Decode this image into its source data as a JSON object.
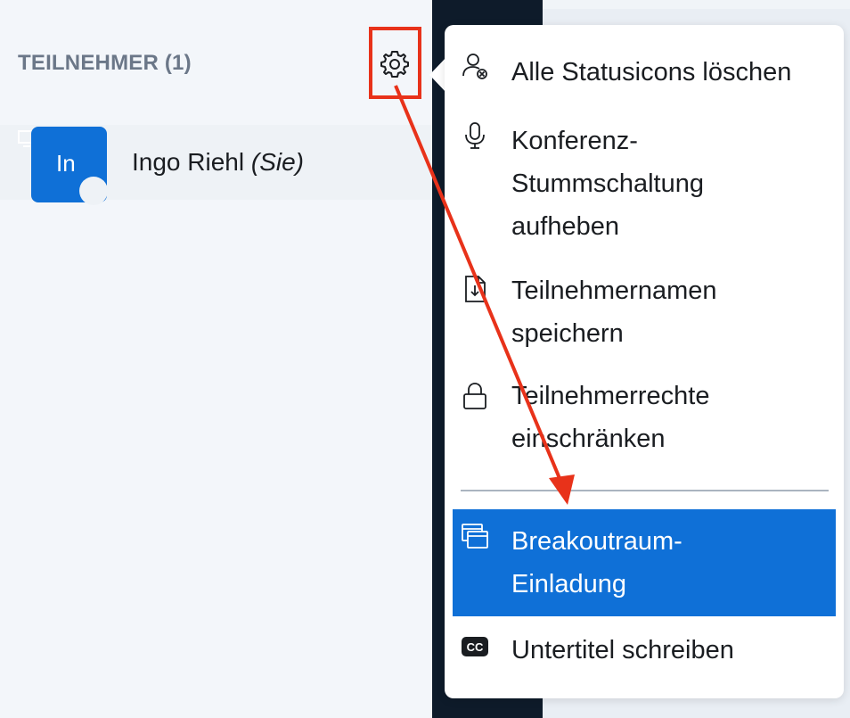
{
  "participants": {
    "title": "TEILNEHMER (1)",
    "user": {
      "initials": "In",
      "name": "Ingo Riehl",
      "suffix": "(Sie)"
    }
  },
  "menu": {
    "items": [
      {
        "label": "Alle Statusicons löschen",
        "icon": "clear-status-icon"
      },
      {
        "label": "Konferenz-\nStummschaltung\naufheben",
        "icon": "microphone-icon"
      },
      {
        "label": "Teilnehmernamen\nspeichern",
        "icon": "save-file-icon"
      },
      {
        "label": "Teilnehmerrechte\neinschränken",
        "icon": "lock-icon"
      },
      {
        "label": "Breakoutraum-\nEinladung",
        "icon": "breakout-room-icon",
        "active": true
      },
      {
        "label": "Untertitel schreiben",
        "icon": "closed-captions-icon"
      }
    ]
  },
  "colors": {
    "accent": "#0f70d7",
    "highlight": "#e8321a",
    "sidebar_bg": "#f3f6fa",
    "dark_strip": "#0e1b2a"
  }
}
